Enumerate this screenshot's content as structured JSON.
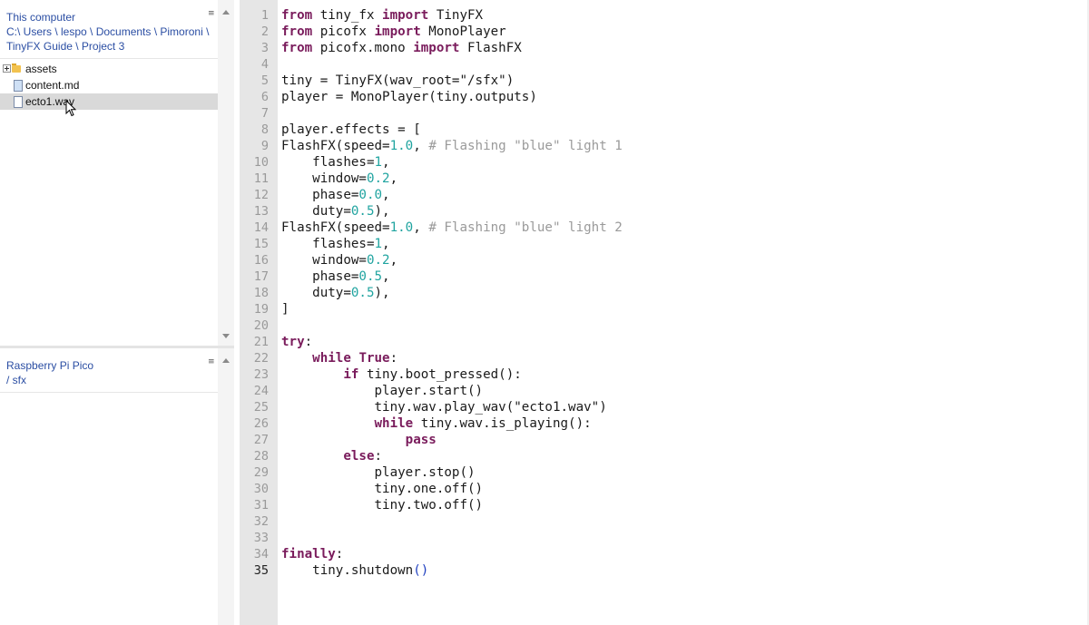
{
  "files_panel": {
    "header_lines": [
      "This computer",
      "C:\\ Users \\ lespo \\ Documents \\ Pimoroni \\",
      "TinyFX Guide \\ Project 3"
    ],
    "menu_icon": "≡",
    "items": [
      {
        "label": "assets",
        "icon": "folder-icon",
        "expander": "plus-icon"
      },
      {
        "label": "content.md",
        "icon": "document-icon"
      },
      {
        "label": "ecto1.wav",
        "icon": "file-icon",
        "selected": true
      }
    ]
  },
  "device_panel": {
    "header_lines": [
      "Raspberry Pi Pico",
      "/ sfx"
    ],
    "menu_icon": "≡"
  },
  "editor": {
    "line_numbers": [
      "1",
      "2",
      "3",
      "4",
      "5",
      "6",
      "7",
      "8",
      "9",
      "10",
      "11",
      "12",
      "13",
      "14",
      "15",
      "16",
      "17",
      "18",
      "19",
      "20",
      "21",
      "22",
      "23",
      "24",
      "25",
      "26",
      "27",
      "28",
      "29",
      "30",
      "31",
      "32",
      "33",
      "34",
      "35"
    ],
    "current_line": "35",
    "lines": [
      [
        {
          "t": "from",
          "c": "kw"
        },
        {
          "t": " tiny_fx "
        },
        {
          "t": "import",
          "c": "kw"
        },
        {
          "t": " TinyFX"
        }
      ],
      [
        {
          "t": "from",
          "c": "kw"
        },
        {
          "t": " picofx "
        },
        {
          "t": "import",
          "c": "kw"
        },
        {
          "t": " MonoPlayer"
        }
      ],
      [
        {
          "t": "from",
          "c": "kw"
        },
        {
          "t": " picofx.mono "
        },
        {
          "t": "import",
          "c": "kw"
        },
        {
          "t": " FlashFX"
        }
      ],
      [
        {
          "t": ""
        }
      ],
      [
        {
          "t": "tiny = TinyFX(wav_root="
        },
        {
          "t": "\"/sfx\"",
          "c": "str"
        },
        {
          "t": ")"
        }
      ],
      [
        {
          "t": "player = MonoPlayer(tiny.outputs)"
        }
      ],
      [
        {
          "t": ""
        }
      ],
      [
        {
          "t": "player.effects = ["
        }
      ],
      [
        {
          "t": "FlashFX(speed="
        },
        {
          "t": "1.0",
          "c": "num"
        },
        {
          "t": ", "
        },
        {
          "t": "# Flashing \"blue\" light 1",
          "c": "com"
        }
      ],
      [
        {
          "t": "    flashes="
        },
        {
          "t": "1",
          "c": "num"
        },
        {
          "t": ","
        }
      ],
      [
        {
          "t": "    window="
        },
        {
          "t": "0.2",
          "c": "num"
        },
        {
          "t": ","
        }
      ],
      [
        {
          "t": "    phase="
        },
        {
          "t": "0.0",
          "c": "num"
        },
        {
          "t": ","
        }
      ],
      [
        {
          "t": "    duty="
        },
        {
          "t": "0.5",
          "c": "num"
        },
        {
          "t": "),"
        }
      ],
      [
        {
          "t": "FlashFX(speed="
        },
        {
          "t": "1.0",
          "c": "num"
        },
        {
          "t": ", "
        },
        {
          "t": "# Flashing \"blue\" light 2",
          "c": "com"
        }
      ],
      [
        {
          "t": "    flashes="
        },
        {
          "t": "1",
          "c": "num"
        },
        {
          "t": ","
        }
      ],
      [
        {
          "t": "    window="
        },
        {
          "t": "0.2",
          "c": "num"
        },
        {
          "t": ","
        }
      ],
      [
        {
          "t": "    phase="
        },
        {
          "t": "0.5",
          "c": "num"
        },
        {
          "t": ","
        }
      ],
      [
        {
          "t": "    duty="
        },
        {
          "t": "0.5",
          "c": "num"
        },
        {
          "t": "),"
        }
      ],
      [
        {
          "t": "]"
        }
      ],
      [
        {
          "t": ""
        }
      ],
      [
        {
          "t": "try",
          "c": "kw"
        },
        {
          "t": ":"
        }
      ],
      [
        {
          "t": "    "
        },
        {
          "t": "while",
          "c": "kw"
        },
        {
          "t": " "
        },
        {
          "t": "True",
          "c": "kw"
        },
        {
          "t": ":"
        }
      ],
      [
        {
          "t": "        "
        },
        {
          "t": "if",
          "c": "kw"
        },
        {
          "t": " tiny.boot_pressed():"
        }
      ],
      [
        {
          "t": "            player.start()"
        }
      ],
      [
        {
          "t": "            tiny.wav.play_wav("
        },
        {
          "t": "\"ecto1.wav\"",
          "c": "str"
        },
        {
          "t": ")"
        }
      ],
      [
        {
          "t": "            "
        },
        {
          "t": "while",
          "c": "kw"
        },
        {
          "t": " tiny.wav.is_playing():"
        }
      ],
      [
        {
          "t": "                "
        },
        {
          "t": "pass",
          "c": "kw"
        }
      ],
      [
        {
          "t": "        "
        },
        {
          "t": "else",
          "c": "kw"
        },
        {
          "t": ":"
        }
      ],
      [
        {
          "t": "            player.stop()"
        }
      ],
      [
        {
          "t": "            tiny.one.off()"
        }
      ],
      [
        {
          "t": "            tiny.two.off()"
        }
      ],
      [
        {
          "t": ""
        }
      ],
      [
        {
          "t": ""
        }
      ],
      [
        {
          "t": "finally",
          "c": "kw"
        },
        {
          "t": ":"
        }
      ],
      [
        {
          "t": "    tiny.shutdown"
        },
        {
          "t": "()",
          "c": "paren-hl"
        }
      ]
    ]
  },
  "colors": {
    "keyword": "#7a1c5c",
    "number": "#20a4a0",
    "comment": "#9a9a9a",
    "link": "#2b4ea3",
    "selection": "#d9d9d9"
  }
}
